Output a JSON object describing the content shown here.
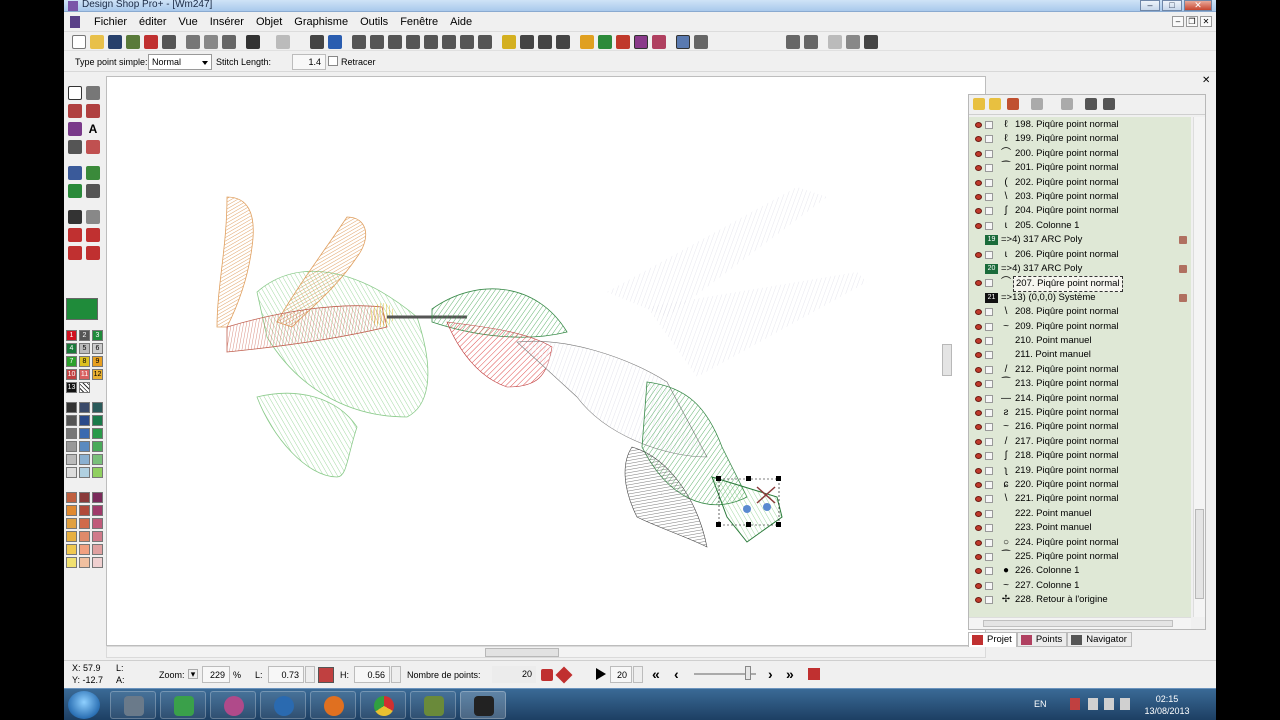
{
  "window": {
    "title": "Design Shop Pro+ - [Wm247]"
  },
  "menu": [
    "Fichier",
    "éditer",
    "Vue",
    "Insérer",
    "Objet",
    "Graphisme",
    "Outils",
    "Fenêtre",
    "Aide"
  ],
  "props_bar": {
    "type_label": "Type point simple:",
    "type_value": "Normal",
    "stitch_label": "Stitch Length:",
    "stitch_value": "1.4",
    "retracer_label": "Retracer"
  },
  "palette": {
    "current_color": "#1f8b3a",
    "numbered": [
      "1",
      "2",
      "3",
      "4",
      "5",
      "6",
      "7",
      "8",
      "9",
      "10",
      "11",
      "12",
      "13"
    ]
  },
  "layers": [
    {
      "glyph": "ℓ",
      "text": "198. Piqûre point normal"
    },
    {
      "glyph": "ℓ",
      "text": "199. Piqûre point normal"
    },
    {
      "glyph": "⌒",
      "text": "200. Piqûre point normal"
    },
    {
      "glyph": "⁀",
      "text": "201. Piqûre point normal"
    },
    {
      "glyph": "(",
      "text": "202. Piqûre point normal"
    },
    {
      "glyph": "\\",
      "text": "203. Piqûre point normal"
    },
    {
      "glyph": "ʃ",
      "text": "204. Piqûre point normal"
    },
    {
      "glyph": "ɩ",
      "text": "205. Colonne 1"
    },
    {
      "group": true,
      "badge": "19",
      "text": "=>4) 317 ARC Poly",
      "locked": true
    },
    {
      "glyph": "ɩ",
      "text": "206. Piqûre point normal"
    },
    {
      "group": true,
      "badge": "20",
      "text": "=>4) 317 ARC Poly",
      "locked": true
    },
    {
      "glyph": "⌒",
      "text": "207. Piqûre point normal",
      "selected": true
    },
    {
      "group": true,
      "badge": "21",
      "dark": true,
      "text": "=>13) (0,0,0) Système",
      "locked": true
    },
    {
      "glyph": "\\",
      "text": "208. Piqûre point normal"
    },
    {
      "glyph": "~",
      "text": "209. Piqûre point normal"
    },
    {
      "glyph": "",
      "text": "210. Point manuel"
    },
    {
      "glyph": "",
      "text": "211. Point manuel"
    },
    {
      "glyph": "/",
      "text": "212. Piqûre point normal"
    },
    {
      "glyph": "⁀",
      "text": "213. Piqûre point normal"
    },
    {
      "glyph": "—",
      "text": "214. Piqûre point normal"
    },
    {
      "glyph": "ƨ",
      "text": "215. Piqûre point normal"
    },
    {
      "glyph": "~",
      "text": "216. Piqûre point normal"
    },
    {
      "glyph": "/",
      "text": "217. Piqûre point normal"
    },
    {
      "glyph": "ʃ",
      "text": "218. Piqûre point normal"
    },
    {
      "glyph": "ʅ",
      "text": "219. Piqûre point normal"
    },
    {
      "glyph": "ɕ",
      "text": "220. Piqûre point normal"
    },
    {
      "glyph": "\\",
      "text": "221. Piqûre point normal"
    },
    {
      "glyph": "",
      "text": "222. Point manuel"
    },
    {
      "glyph": "",
      "text": "223. Point manuel"
    },
    {
      "glyph": "○",
      "text": "224. Piqûre point normal"
    },
    {
      "glyph": "⁀",
      "text": "225. Piqûre point normal"
    },
    {
      "glyph": "●",
      "text": "226. Colonne 1"
    },
    {
      "glyph": "~",
      "text": "227. Colonne 1"
    },
    {
      "glyph": "✢",
      "text": "228. Retour à l'origine"
    }
  ],
  "tabs": [
    "Projet",
    "Points",
    "Navigator"
  ],
  "status": {
    "x": "X: 57.9",
    "y": "Y: -12.7",
    "l_small": "L:",
    "a_small": "A:",
    "zoom_label": "Zoom:",
    "zoom_value": "229",
    "zoom_unit": "%",
    "l_label": "L:",
    "l_value": "0.73",
    "h_label": "H:",
    "h_value": "0.56",
    "points_label": "Nombre de points:",
    "points_value": "20",
    "speed_value": "20"
  },
  "taskbar": {
    "lang": "EN",
    "time": "02:15",
    "date": "13/08/2013"
  }
}
